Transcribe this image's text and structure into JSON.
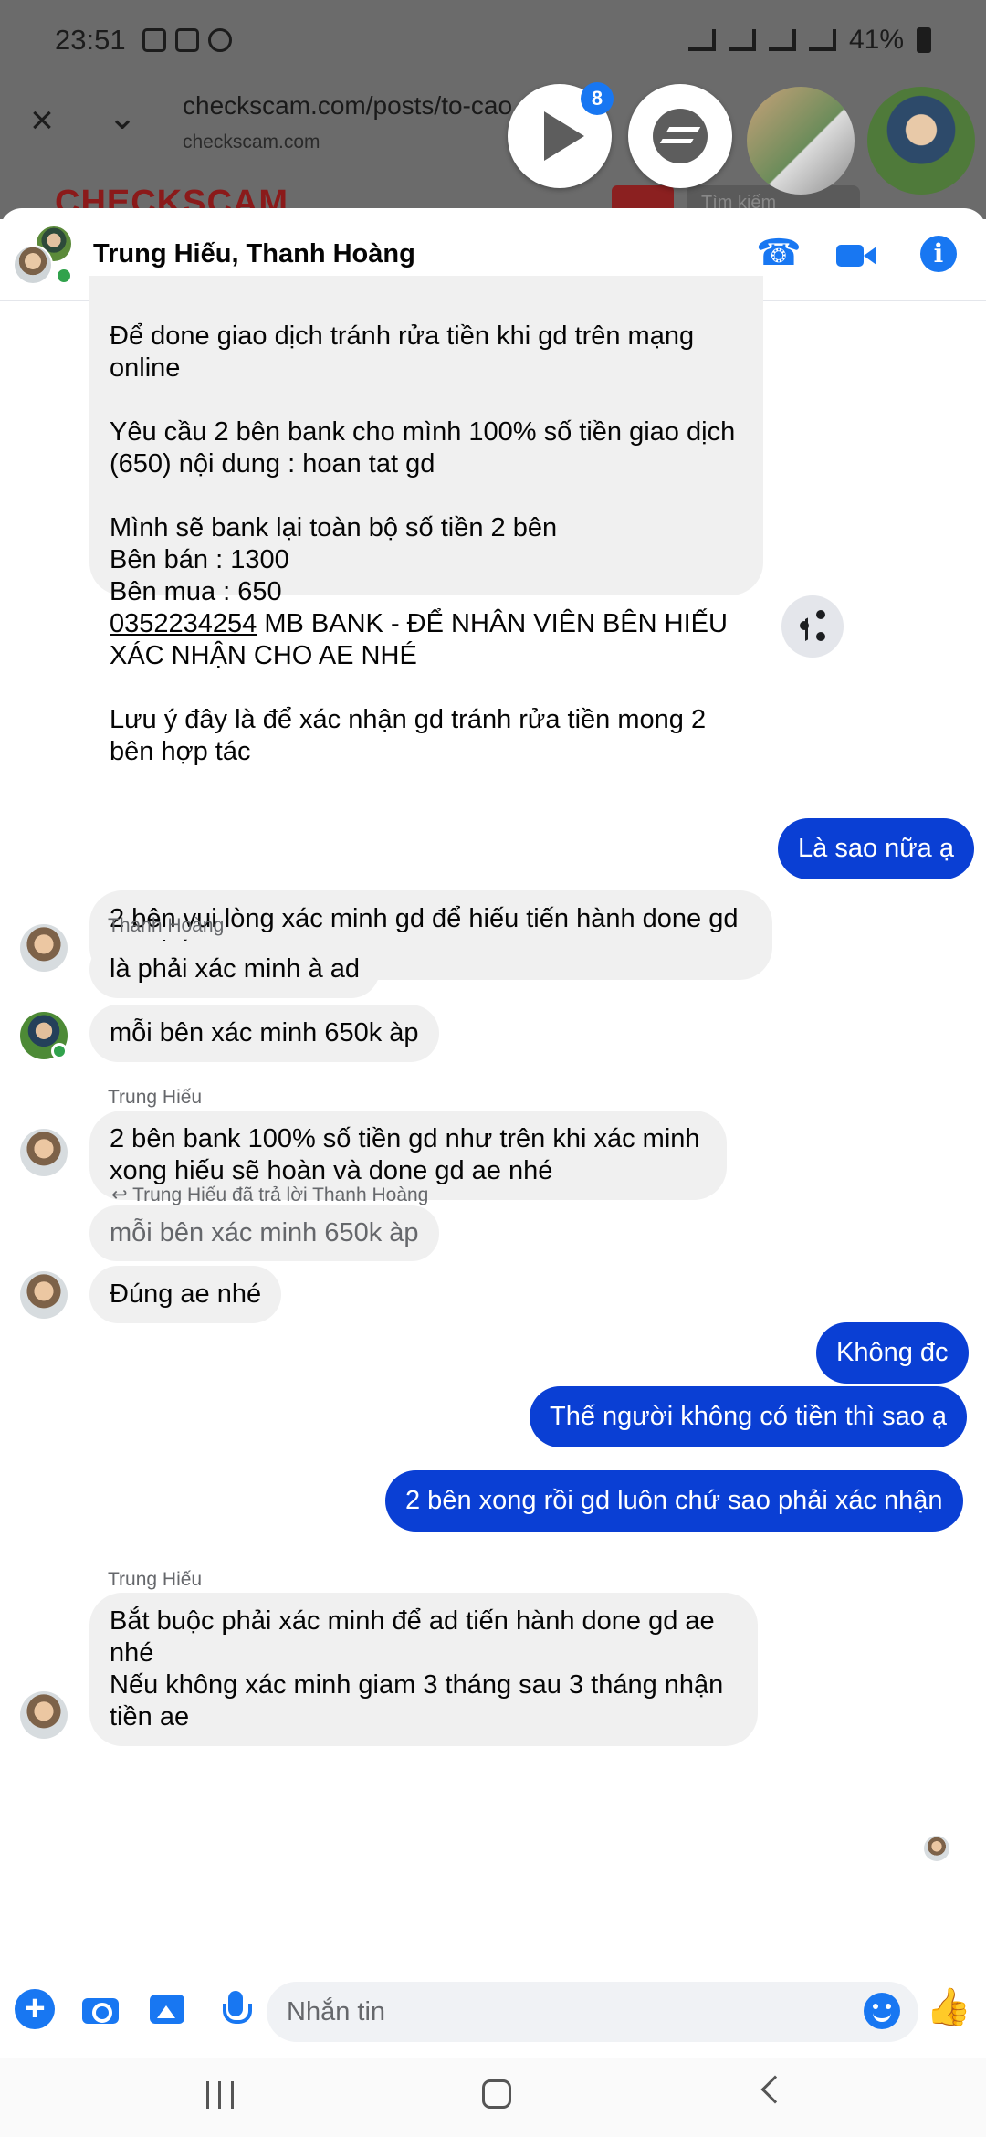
{
  "status_bar": {
    "time": "23:51",
    "battery": "41%"
  },
  "browser": {
    "title": "checkscam.com/posts/to-cao",
    "domain": "checkscam.com"
  },
  "site": {
    "logo": "CHECKSCAM",
    "search_placeholder": "Tìm kiếm"
  },
  "chat_heads": {
    "badge_count": "8"
  },
  "chat_header": {
    "title": "Trung Hiếu, Thanh Hoàng"
  },
  "messages": {
    "m1": "Để done giao dịch tránh rửa tiền khi gd trên mạng\nonline\n\nYêu cầu 2 bên bank cho mình 100% số tiền giao dịch\n(650) nội dung : hoan tat gd\n\nMình sẽ bank lại toàn bộ số tiền 2 bên\nBên bán : 1300\nBên mua : 650\n",
    "m1_acct": "0352234254",
    "m1_acct_rest": " MB BANK - ĐỂ NHÂN VIÊN BÊN HIẾU\nXÁC NHẬN CHO AE NHÉ\n\nLưu ý đây là để xác nhận gd tránh rửa tiền mong 2\nbên hợp tác",
    "m2": "2 bên vui lòng xác minh gd để hiếu tiến hành done gd\nae nhé",
    "m3": "Là sao nữa ạ",
    "sender_hoang": "Thanh Hoàng",
    "m4": "là phải xác minh à ad",
    "m5": "mỗi bên xác minh 650k àp",
    "sender_hieu_1": "Trung Hiếu",
    "m6": "2 bên bank 100% số tiền gd như trên khi xác minh\nxong hiếu sẽ hoàn và done gd ae nhé",
    "reply_note": "Trung Hiếu đã trả lời Thanh Hoàng",
    "quoted": "mỗi bên xác minh 650k àp",
    "m7": "Đúng ae nhé",
    "m8": "Không đc",
    "m9": "Thế người không có tiền thì sao ạ",
    "m10": "2 bên xong rồi gd luôn chứ sao phải xác nhận",
    "sender_hieu_2": "Trung Hiếu",
    "m11": "Bắt buộc phải xác minh để ad tiến hành done gd ae\nnhé\nNếu không xác minh giam 3 tháng sau 3 tháng nhận\ntiền ae"
  },
  "composer": {
    "placeholder": "Nhắn tin"
  },
  "colors": {
    "accent": "#1877f2",
    "outgoing": "#0a3fd4",
    "incoming": "#f0f0f0"
  }
}
